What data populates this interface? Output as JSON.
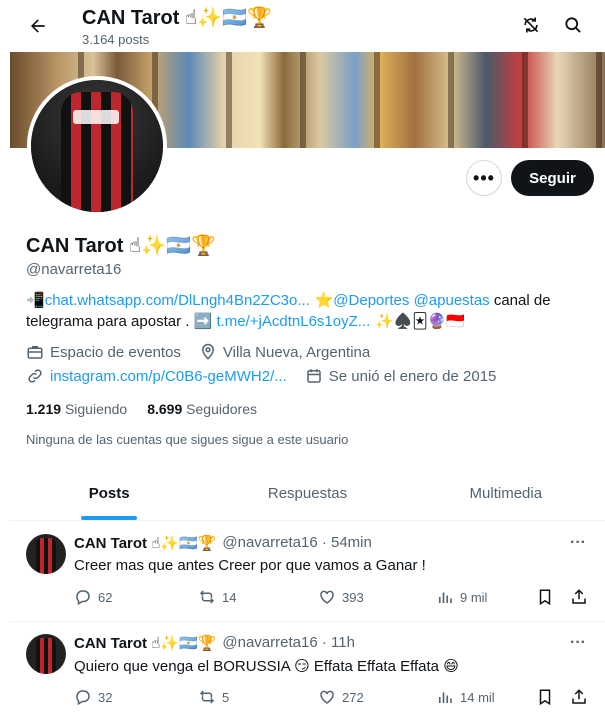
{
  "header": {
    "name": "CAN Tarot ☝✨🇦🇷🏆",
    "post_count": "3.164 posts"
  },
  "profile": {
    "name": "CAN Tarot ☝✨🇦🇷🏆",
    "handle": "@navarreta16",
    "follow_label": "Seguir",
    "more_label": "•••",
    "bio": {
      "prefix": "📲",
      "link1": "chat.whatsapp.com/DlLngh4Bn2ZC3o...",
      "star": " ⭐",
      "mention1": "@Deportes",
      "mention2": "@apuestas",
      "text1": " canal de telegrama para apostar . ➡️ ",
      "link2": "t.me/+jAcdtnL6s1oyZ...",
      "suffix": " ✨♠️🃏🔮🇮🇩"
    },
    "category": "Espacio de eventos",
    "location": "Villa Nueva, Argentina",
    "website": "instagram.com/p/C0B6-geMWH2/...",
    "joined": "Se unió el enero de 2015",
    "following_count": "1.219",
    "following_label": "Siguiendo",
    "followers_count": "8.699",
    "followers_label": "Seguidores",
    "followed_by_note": "Ninguna de las cuentas que sigues sigue a este usuario"
  },
  "tabs": [
    "Posts",
    "Respuestas",
    "Multimedia"
  ],
  "tweets": [
    {
      "name": "CAN Tarot ☝✨🇦🇷🏆",
      "meta": "@navarreta16 · 54min",
      "text": "Creer mas que antes Creer por que vamos a Ganar !",
      "replies": "62",
      "retweets": "14",
      "likes": "393",
      "views": "9 mil"
    },
    {
      "name": "CAN Tarot ☝✨🇦🇷🏆",
      "meta": "@navarreta16 · 11h",
      "text": "Quiero que venga el BORUSSIA 😏 Effata Effata Effata 😄",
      "replies": "32",
      "retweets": "5",
      "likes": "272",
      "views": "14 mil"
    }
  ],
  "colors": {
    "accent": "#1d9bf0",
    "text": "#0f1419",
    "muted": "#536471"
  },
  "icons": [
    "back-arrow-icon",
    "no-sync-icon",
    "search-icon",
    "phone-icon",
    "briefcase-icon",
    "location-pin-icon",
    "link-icon",
    "calendar-icon",
    "reply-icon",
    "retweet-icon",
    "heart-icon",
    "views-icon",
    "bookmark-icon",
    "share-icon"
  ]
}
